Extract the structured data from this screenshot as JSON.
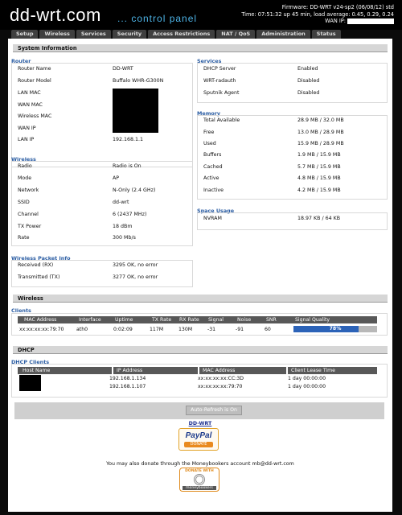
{
  "header": {
    "logo": "dd-wrt.com",
    "subtitle": "... control panel",
    "firmware": "Firmware: DD-WRT v24-sp2 (06/08/12) std",
    "time": "Time: 07:51:32 up 45 min, load average: 0.45, 0.29, 0.24",
    "wan_ip_label": "WAN IP:"
  },
  "tabs": [
    "Setup",
    "Wireless",
    "Services",
    "Security",
    "Access Restrictions",
    "NAT / QoS",
    "Administration",
    "Status"
  ],
  "system_info": {
    "title": "System Information",
    "router": {
      "title": "Router",
      "rows": [
        {
          "label": "Router Name",
          "value": "DD-WRT"
        },
        {
          "label": "Router Model",
          "value": "Buffalo WHR-G300N"
        },
        {
          "label": "LAN MAC",
          "value": ""
        },
        {
          "label": "WAN MAC",
          "value": ""
        },
        {
          "label": "Wireless MAC",
          "value": ""
        },
        {
          "label": "WAN IP",
          "value": ""
        },
        {
          "label": "LAN IP",
          "value": "192.168.1.1"
        }
      ]
    },
    "services": {
      "title": "Services",
      "rows": [
        {
          "label": "DHCP Server",
          "value": "Enabled"
        },
        {
          "label": "WRT-radauth",
          "value": "Disabled"
        },
        {
          "label": "Sputnik Agent",
          "value": "Disabled"
        }
      ]
    },
    "memory": {
      "title": "Memory",
      "rows": [
        {
          "label": "Total Available",
          "value": "28.9 MB / 32.0 MB"
        },
        {
          "label": "Free",
          "value": "13.0 MB / 28.9 MB"
        },
        {
          "label": "Used",
          "value": "15.9 MB / 28.9 MB"
        },
        {
          "label": "Buffers",
          "value": "1.9 MB / 15.9 MB"
        },
        {
          "label": "Cached",
          "value": "5.7 MB / 15.9 MB"
        },
        {
          "label": "Active",
          "value": "4.8 MB / 15.9 MB"
        },
        {
          "label": "Inactive",
          "value": "4.2 MB / 15.9 MB"
        }
      ]
    },
    "wireless": {
      "title": "Wireless",
      "rows": [
        {
          "label": "Radio",
          "value": "Radio is On"
        },
        {
          "label": "Mode",
          "value": "AP"
        },
        {
          "label": "Network",
          "value": "N-Only (2.4 GHz)"
        },
        {
          "label": "SSID",
          "value": "dd-wrt"
        },
        {
          "label": "Channel",
          "value": "6 (2437 MHz)"
        },
        {
          "label": "TX Power",
          "value": "18 dBm"
        },
        {
          "label": "Rate",
          "value": "300 Mb/s"
        }
      ]
    },
    "space_usage": {
      "title": "Space Usage",
      "rows": [
        {
          "label": "NVRAM",
          "value": "18.97 KB / 64 KB"
        }
      ]
    },
    "packet_info": {
      "title": "Wireless Packet Info",
      "rows": [
        {
          "label": "Received (RX)",
          "value": "3295 OK, no error"
        },
        {
          "label": "Transmitted (TX)",
          "value": "3277 OK, no error"
        }
      ]
    }
  },
  "wireless_section": {
    "title": "Wireless",
    "clients_title": "Clients",
    "headers": [
      "MAC Address",
      "Interface",
      "Uptime",
      "TX Rate",
      "RX Rate",
      "Signal",
      "Noise",
      "SNR",
      "Signal Quality"
    ],
    "row": [
      "xx:xx:xx:xx:79:70",
      "ath0",
      "0:02:09",
      "117M",
      "130M",
      "-31",
      "-91",
      "60"
    ],
    "signal_quality": 0.78,
    "signal_quality_text": "78%"
  },
  "dhcp": {
    "title": "DHCP",
    "clients_title": "DHCP Clients",
    "headers": [
      "Host Name",
      "IP Address",
      "MAC Address",
      "Client Lease Time"
    ],
    "rows": [
      {
        "ip": "192.168.1.134",
        "mac": "xx:xx:xx:xx:CC:3D",
        "lease": "1 day 00:00:00"
      },
      {
        "ip": "192.168.1.107",
        "mac": "xx:xx:xx:xx:79:70",
        "lease": "1 day 00:00:00"
      }
    ]
  },
  "footer": {
    "refresh_label": "Auto-Refresh is On",
    "ddwrt_link": "DD-WRT",
    "paypal": "PayPal",
    "paypal_donate": "DONATE",
    "moneybookers_text": "You may also donate through the Moneybookers account mb@dd-wrt.com",
    "mb_donate_with": "DONATE WITH",
    "mb_brand": "moneybookers"
  },
  "colors": {
    "accent": "#4db3e6",
    "section_title": "#2b5da3",
    "signal_fill": "#2c63b8"
  }
}
